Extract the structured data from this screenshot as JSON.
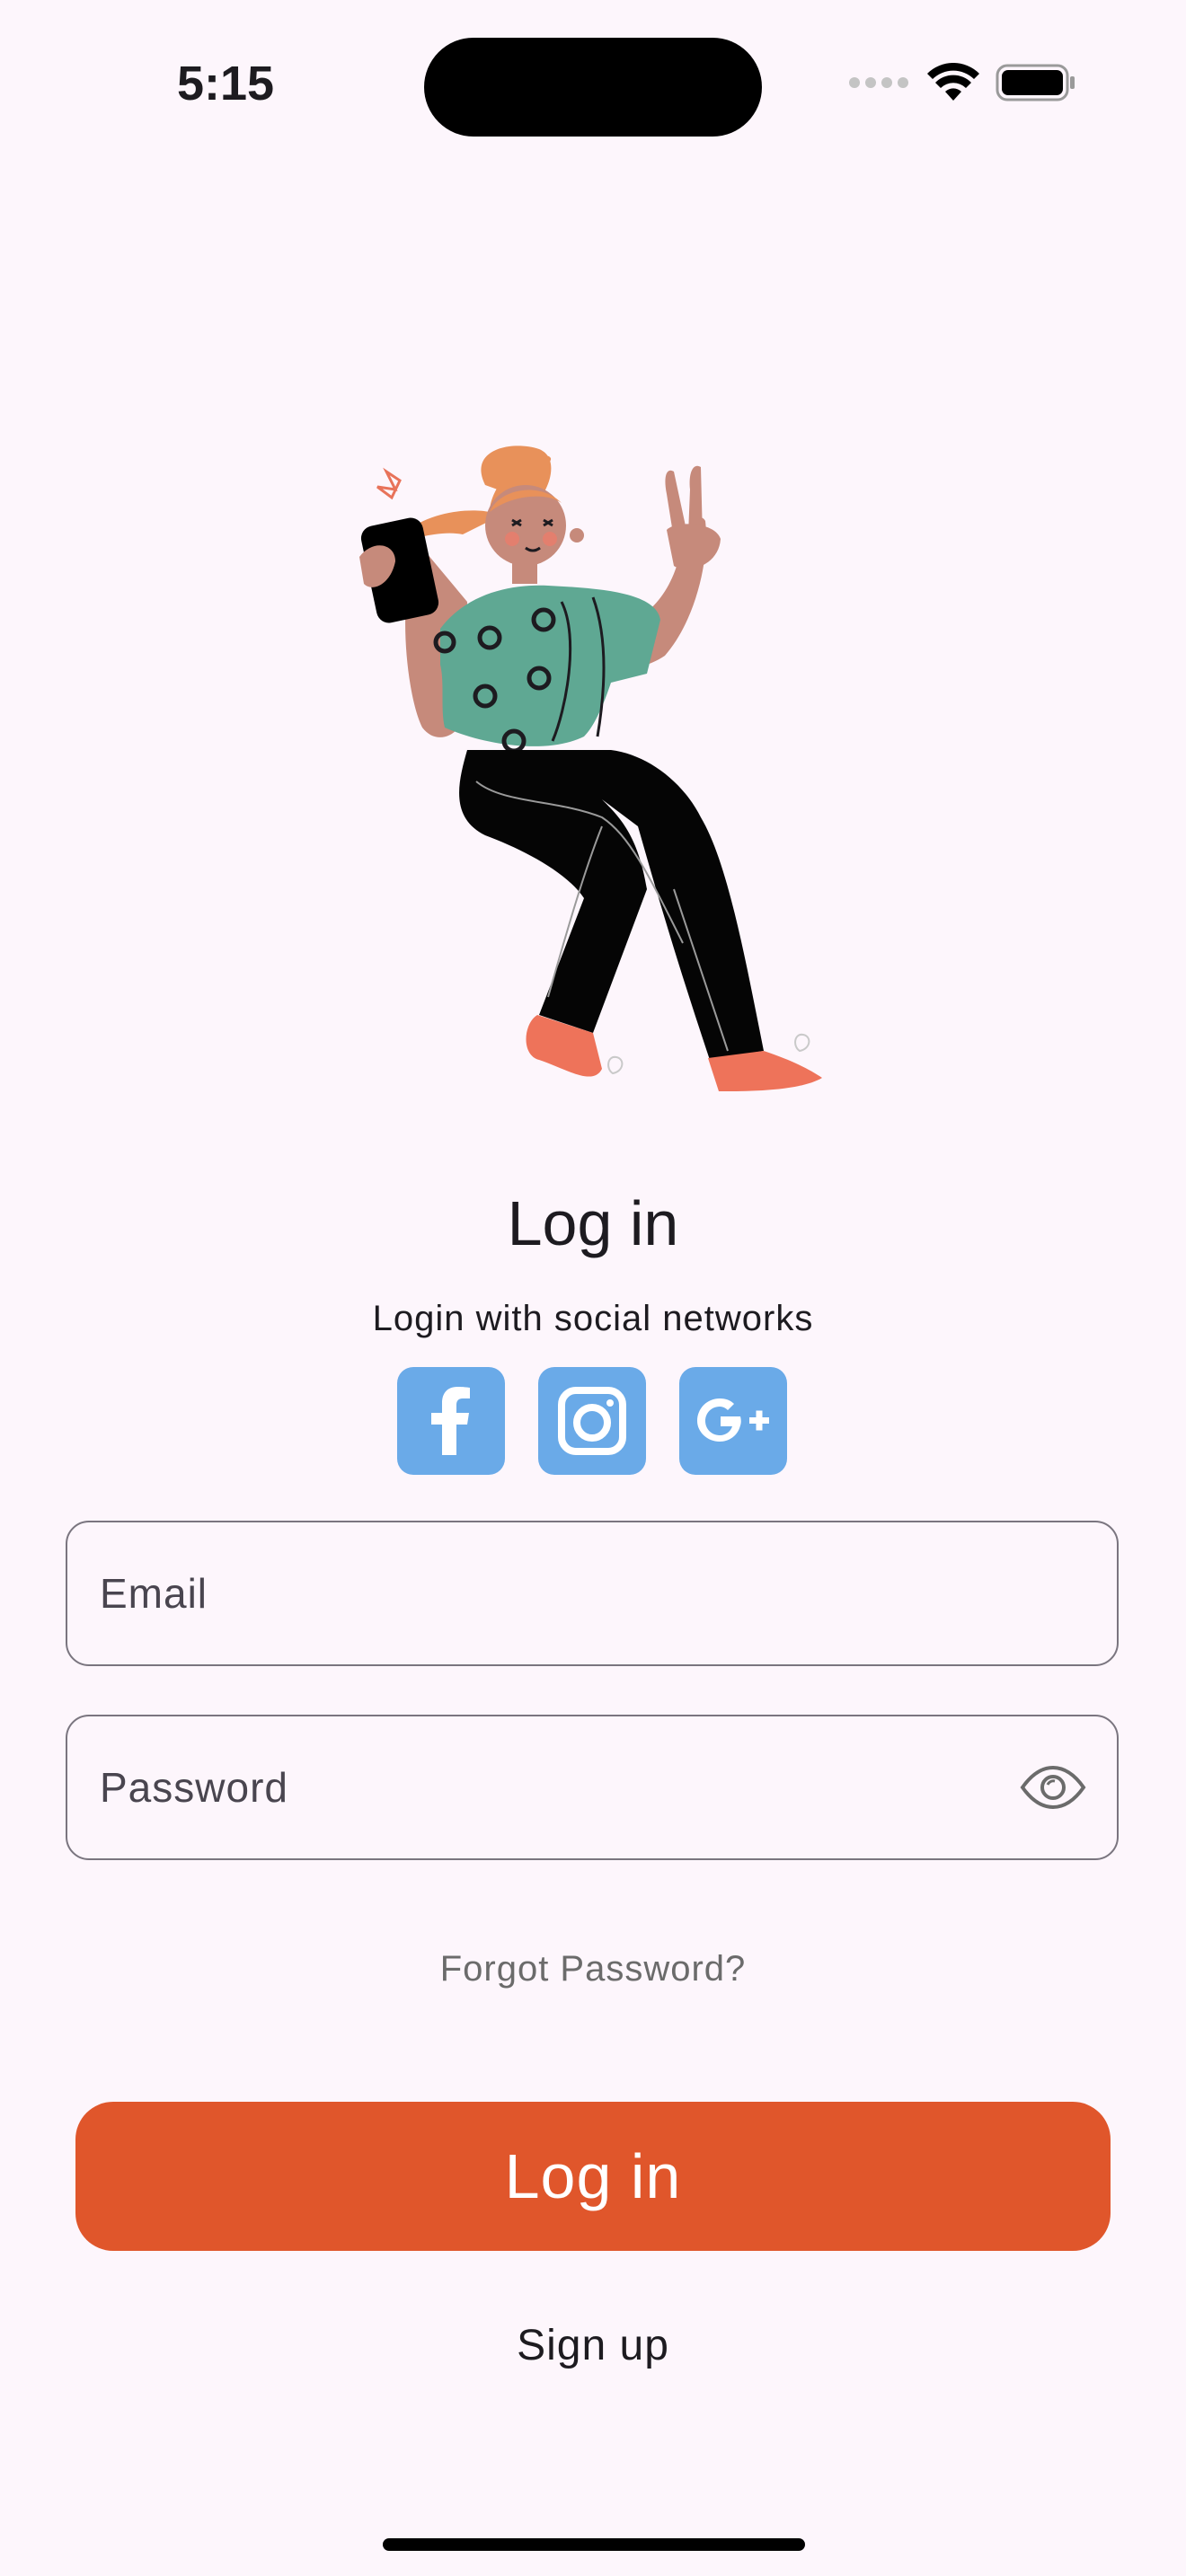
{
  "status_bar": {
    "time": "5:15",
    "signal_icon": "signal-dots-icon",
    "wifi_icon": "wifi-icon",
    "battery_icon": "battery-icon"
  },
  "illustration": {
    "icon": "woman-with-phone-illustration"
  },
  "header": {
    "title": "Log in",
    "subtitle": "Login with social networks"
  },
  "social": [
    {
      "name": "facebook",
      "icon": "facebook-icon",
      "color": "#6aaae8"
    },
    {
      "name": "instagram",
      "icon": "instagram-icon",
      "color": "#6aaae8"
    },
    {
      "name": "google-plus",
      "icon": "google-plus-icon",
      "color": "#6aaae8"
    }
  ],
  "form": {
    "email_label": "Email",
    "password_label": "Password",
    "password_visibility_icon": "eye-icon",
    "forgot_password": "Forgot Password?",
    "login_button": "Log in",
    "signup_link": "Sign up"
  },
  "colors": {
    "background": "#fdf6fc",
    "primary_button": "#e0562b",
    "social_button": "#6aaae8"
  }
}
